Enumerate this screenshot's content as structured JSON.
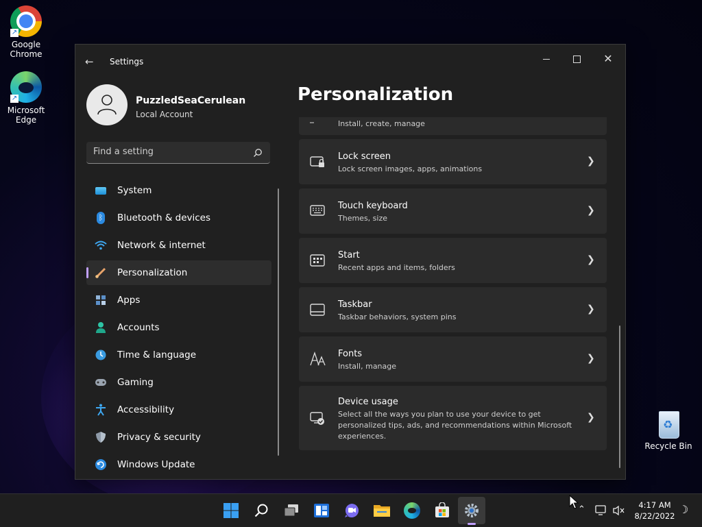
{
  "desktop": {
    "icons": [
      {
        "label": "Google Chrome"
      },
      {
        "label": "Microsoft Edge"
      },
      {
        "label": "Recycle Bin"
      }
    ]
  },
  "window": {
    "title": "Settings",
    "controls": {
      "minimize": "minimize",
      "maximize": "maximize",
      "close": "close"
    }
  },
  "profile": {
    "name": "PuzzledSeaCerulean",
    "account_type": "Local Account"
  },
  "search": {
    "placeholder": "Find a setting"
  },
  "nav": {
    "items": [
      {
        "label": "System",
        "icon": "system-icon",
        "selected": false
      },
      {
        "label": "Bluetooth & devices",
        "icon": "bluetooth-icon",
        "selected": false
      },
      {
        "label": "Network & internet",
        "icon": "wifi-icon",
        "selected": false
      },
      {
        "label": "Personalization",
        "icon": "brush-icon",
        "selected": true
      },
      {
        "label": "Apps",
        "icon": "apps-icon",
        "selected": false
      },
      {
        "label": "Accounts",
        "icon": "person-icon",
        "selected": false
      },
      {
        "label": "Time & language",
        "icon": "clock-globe-icon",
        "selected": false
      },
      {
        "label": "Gaming",
        "icon": "gamepad-icon",
        "selected": false
      },
      {
        "label": "Accessibility",
        "icon": "accessibility-icon",
        "selected": false
      },
      {
        "label": "Privacy & security",
        "icon": "shield-icon",
        "selected": false
      },
      {
        "label": "Windows Update",
        "icon": "update-icon",
        "selected": false
      }
    ]
  },
  "page": {
    "title": "Personalization",
    "cards": [
      {
        "title": "",
        "desc": "Install, create, manage",
        "icon": "themes-icon"
      },
      {
        "title": "Lock screen",
        "desc": "Lock screen images, apps, animations",
        "icon": "lock-screen-icon"
      },
      {
        "title": "Touch keyboard",
        "desc": "Themes, size",
        "icon": "keyboard-icon"
      },
      {
        "title": "Start",
        "desc": "Recent apps and items, folders",
        "icon": "start-icon"
      },
      {
        "title": "Taskbar",
        "desc": "Taskbar behaviors, system pins",
        "icon": "taskbar-icon"
      },
      {
        "title": "Fonts",
        "desc": "Install, manage",
        "icon": "fonts-icon"
      },
      {
        "title": "Device usage",
        "desc": "Select all the ways you plan to use your device to get personalized tips, ads, and recommendations within Microsoft experiences.",
        "icon": "device-usage-icon"
      }
    ]
  },
  "taskbar": {
    "apps": [
      "start-icon",
      "search-icon",
      "task-view-icon",
      "widgets-icon",
      "chat-icon",
      "file-explorer-icon",
      "edge-icon",
      "store-icon",
      "settings-icon"
    ],
    "clock": {
      "time": "4:17 AM",
      "date": "8/22/2022"
    }
  }
}
